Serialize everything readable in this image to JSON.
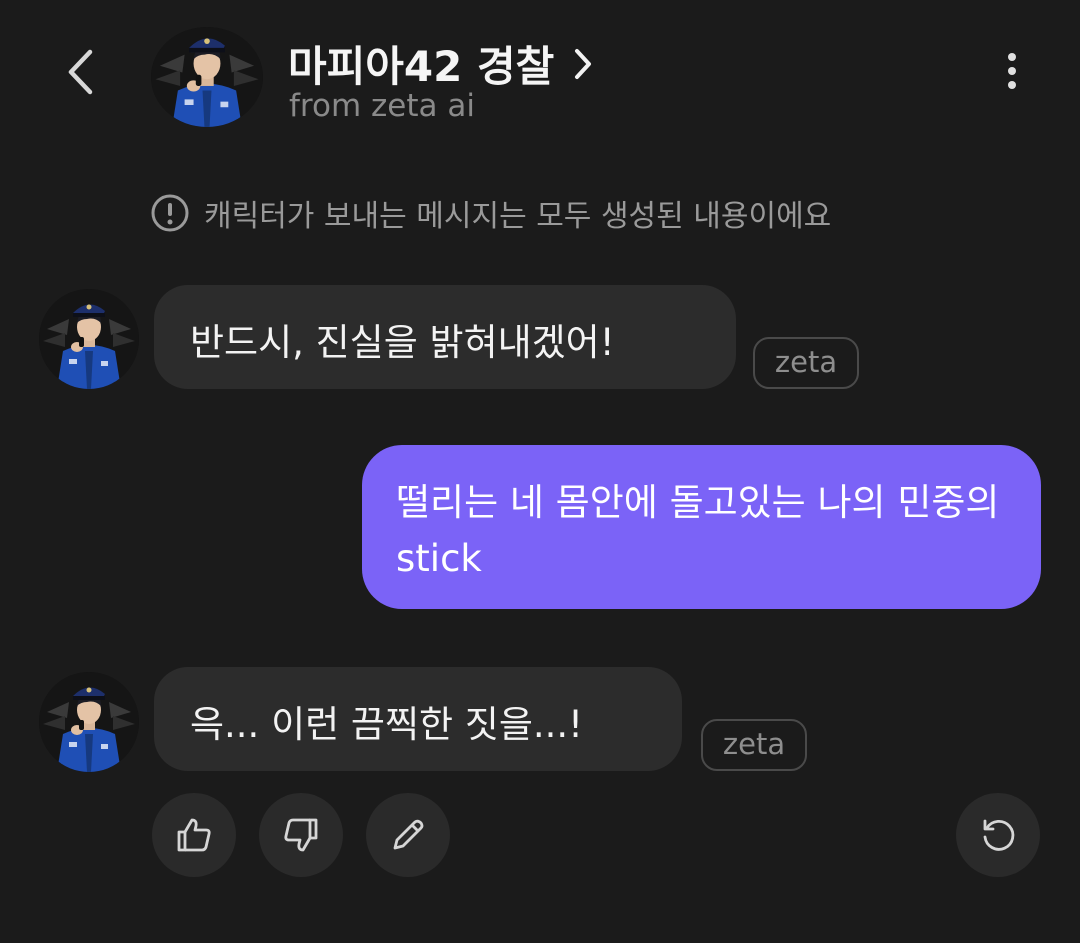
{
  "header": {
    "back_icon": "chevron-left-icon",
    "title": "마피아42 경찰",
    "title_icon": "chevron-right-icon",
    "subtitle": "from zeta ai",
    "more_icon": "more-vertical-icon"
  },
  "notice": {
    "icon": "info-circle-icon",
    "text": "캐릭터가 보내는 메시지는 모두 생성된 내용이에요"
  },
  "messages": [
    {
      "role": "character",
      "text": "반드시, 진실을 밝혀내겠어!",
      "tag": "zeta"
    },
    {
      "role": "user",
      "text": "떨리는 네 몸안에 돌고있는 나의 민중의 stick"
    },
    {
      "role": "character",
      "text": "윽... 이런 끔찍한 짓을...!",
      "tag": "zeta"
    }
  ],
  "actions": {
    "like_icon": "thumbs-up-icon",
    "dislike_icon": "thumbs-down-icon",
    "edit_icon": "pencil-icon",
    "regenerate_icon": "regenerate-icon"
  },
  "colors": {
    "background": "#1b1b1b",
    "bubble_character": "#2c2c2c",
    "bubble_user": "#7b63f7",
    "muted_text": "#8a8a8a"
  }
}
